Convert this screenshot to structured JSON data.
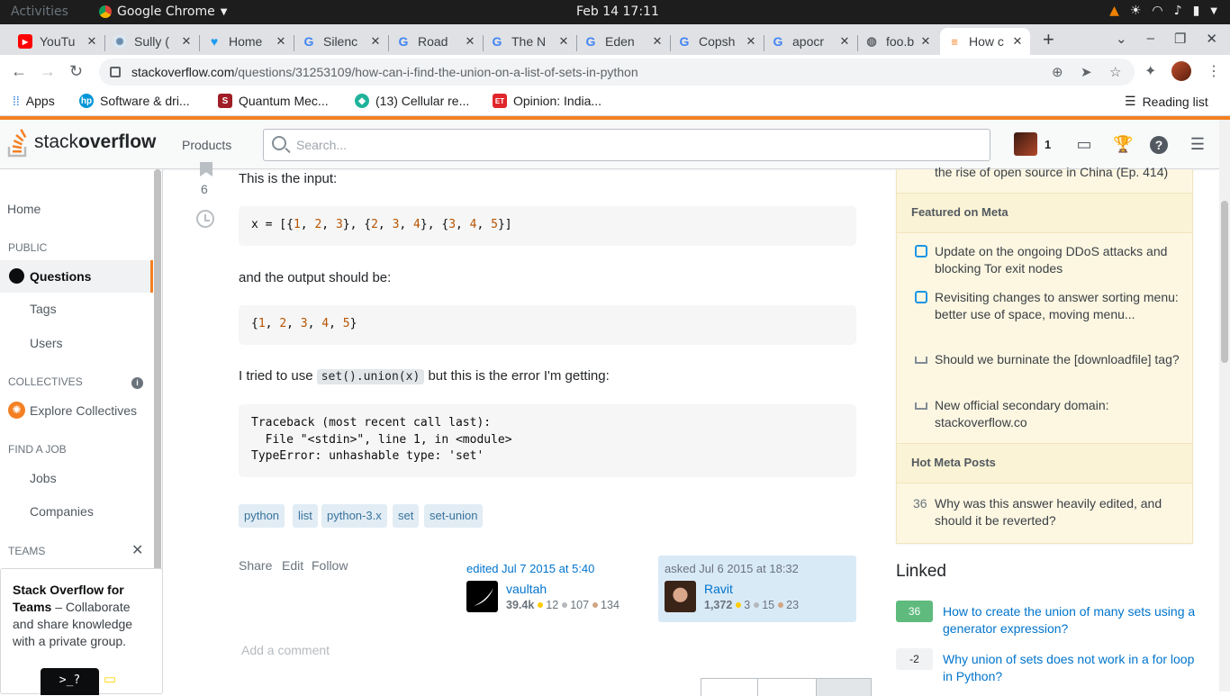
{
  "system": {
    "activities": "Activities",
    "app_name": "Google Chrome",
    "clock": "Feb 14  17:11"
  },
  "tabs": [
    {
      "title": "YouTu",
      "icon": "youtube-icon",
      "color": "#ff0000"
    },
    {
      "title": "Sully (",
      "icon": "site-icon",
      "color": "#6a8caf"
    },
    {
      "title": "Home",
      "icon": "twitter-icon",
      "color": "#1d9bf0"
    },
    {
      "title": "Silenc",
      "icon": "google-icon",
      "color": "#4285f4"
    },
    {
      "title": "Road",
      "icon": "google-icon",
      "color": "#4285f4"
    },
    {
      "title": "The N",
      "icon": "google-icon",
      "color": "#4285f4"
    },
    {
      "title": "Eden",
      "icon": "google-icon",
      "color": "#4285f4"
    },
    {
      "title": "Copsh",
      "icon": "google-icon",
      "color": "#4285f4"
    },
    {
      "title": "apocr",
      "icon": "google-icon",
      "color": "#4285f4"
    },
    {
      "title": "foo.b",
      "icon": "globe-icon",
      "color": "#5f6368"
    },
    {
      "title": "How c",
      "icon": "stackoverflow-icon",
      "color": "#f48024"
    }
  ],
  "address": {
    "host": "stackoverflow.com",
    "path": "/questions/31253109/how-can-i-find-the-union-on-a-list-of-sets-in-python"
  },
  "bookmarks": [
    {
      "label": "Apps"
    },
    {
      "label": "Software & dri..."
    },
    {
      "label": "Quantum Mec..."
    },
    {
      "label": "(13) Cellular re..."
    },
    {
      "label": "Opinion: India..."
    }
  ],
  "reading_list": "Reading list",
  "so_header": {
    "logo_plain": "stack",
    "logo_bold": "overflow",
    "products": "Products",
    "search_placeholder": "Search...",
    "reputation": "1"
  },
  "leftnav": {
    "home": "Home",
    "public": "PUBLIC",
    "questions": "Questions",
    "tags": "Tags",
    "users": "Users",
    "collectives": "COLLECTIVES",
    "explore_collectives": "Explore Collectives",
    "find_a_job": "FIND A JOB",
    "jobs": "Jobs",
    "companies": "Companies",
    "teams": "TEAMS",
    "teams_title": "Stack Overflow for Teams",
    "teams_text": " – Collaborate and share knowledge with a private group.",
    "teams_button": ">_?"
  },
  "question": {
    "vote_count": "6",
    "p1": "This is the input:",
    "code1_prefix": "x = [{",
    "p2": "and the output should be:",
    "p3_a": "I tried to use ",
    "p3_code": "set().union(x)",
    "p3_b": " but this is the error I'm getting:",
    "traceback": "Traceback (most recent call last):\n  File \"<stdin>\", line 1, in <module>\nTypeError: unhashable type: 'set'",
    "tags": [
      "python",
      "list",
      "python-3.x",
      "set",
      "set-union"
    ],
    "actions": [
      "Share",
      "Edit",
      "Follow"
    ],
    "edited": {
      "meta": "edited Jul 7 2015 at 5:40",
      "user": "vaultah",
      "rep": "39.4k",
      "gold": "12",
      "silver": "107",
      "bronze": "134"
    },
    "asked": {
      "meta": "asked Jul 6 2015 at 18:32",
      "user": "Ravit",
      "rep": "1,372",
      "gold": "3",
      "silver": "15",
      "bronze": "23"
    },
    "add_comment": "Add a comment"
  },
  "sidebar": {
    "prev_item": "the rise of open source in China (Ep. 414)",
    "featured_meta": "Featured on Meta",
    "featured_items": [
      "Update on the ongoing DDoS attacks and blocking Tor exit nodes",
      "Revisiting changes to answer sorting menu: better use of space, moving menu...",
      "Should we burninate the [downloadfile] tag?",
      "New official secondary domain: stackoverflow.co"
    ],
    "hot_meta": "Hot Meta Posts",
    "hot_count": "36",
    "hot_item": "Why was this answer heavily edited, and should it be reverted?",
    "linked_title": "Linked",
    "linked": [
      {
        "count": "36",
        "title": "How to create the union of many sets using a generator expression?"
      },
      {
        "count": "-2",
        "title": "Why union of sets does not work in a for loop in Python?"
      }
    ]
  }
}
